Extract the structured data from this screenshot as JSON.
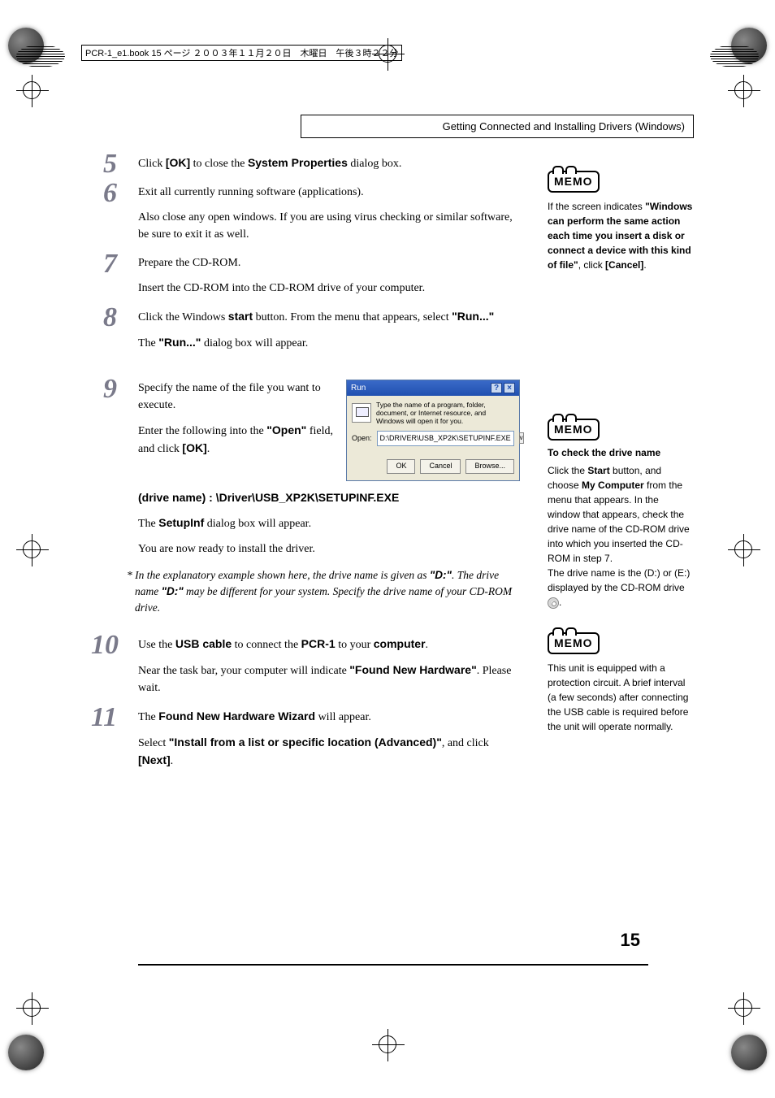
{
  "running_head": "PCR-1_e1.book 15 ページ ２００３年１１月２０日　木曜日　午後３時２２分",
  "section_title": "Getting Connected and Installing Drivers (Windows)",
  "page_number": "15",
  "steps": {
    "s5": {
      "num": "5",
      "p1_a": "Click ",
      "p1_b": "[OK]",
      "p1_c": " to close the ",
      "p1_d": "System Properties",
      "p1_e": " dialog box."
    },
    "s6": {
      "num": "6",
      "p1": "Exit all currently running software (applications).",
      "p2": "Also close any open windows. If you are using virus checking or similar software, be sure to exit it as well."
    },
    "s7": {
      "num": "7",
      "p1": "Prepare the CD-ROM.",
      "p2": "Insert the CD-ROM into the CD-ROM drive of your computer."
    },
    "s8": {
      "num": "8",
      "p1_a": "Click the Windows ",
      "p1_b": "start",
      "p1_c": " button. From the menu that appears, select ",
      "p1_d": "\"Run...\"",
      "p2_a": "The ",
      "p2_b": "\"Run...\"",
      "p2_c": " dialog box will appear."
    },
    "s9": {
      "num": "9",
      "p1": "Specify the name of the file you want to execute.",
      "p2_a": "Enter the following into the ",
      "p2_b": "\"Open\"",
      "p2_c": " field, and click ",
      "p2_d": "[OK]",
      "p2_e": ".",
      "path": "(drive name) : \\Driver\\USB_XP2K\\SETUPINF.EXE",
      "p3_a": "The ",
      "p3_b": "SetupInf",
      "p3_c": " dialog box will appear.",
      "p4": "You are now ready to install the driver.",
      "note_a": "*  In the explanatory example shown here, the drive name is given as ",
      "note_b": "\"D:\"",
      "note_c": ". The drive name ",
      "note_d": "\"D:\"",
      "note_e": " may be different for your system. Specify the drive name of your CD-ROM drive."
    },
    "s10": {
      "num": "10",
      "p1_a": "Use the ",
      "p1_b": "USB cable",
      "p1_c": " to connect the ",
      "p1_d": "PCR-1",
      "p1_e": " to your ",
      "p1_f": "computer",
      "p1_g": ".",
      "p2_a": "Near the task bar, your computer will indicate ",
      "p2_b": "\"Found New Hardware\"",
      "p2_c": ". Please wait."
    },
    "s11": {
      "num": "11",
      "p1_a": "The ",
      "p1_b": "Found New Hardware Wizard",
      "p1_c": " will appear.",
      "p2_a": "Select ",
      "p2_b": "\"Install from a list or specific location (Advanced)\"",
      "p2_c": ", and click ",
      "p2_d": "[Next]",
      "p2_e": "."
    }
  },
  "run_dialog": {
    "title": "Run",
    "help": "?",
    "close": "×",
    "desc": "Type the name of a program, folder, document, or Internet resource, and Windows will open it for you.",
    "open_label": "Open:",
    "open_value": "D:\\DRIVER\\USB_XP2K\\SETUPINF.EXE",
    "ok": "OK",
    "cancel": "Cancel",
    "browse": "Browse..."
  },
  "memos": {
    "label": "MEMO",
    "m1_a": "If the screen indicates ",
    "m1_b": "\"Windows can perform the same action each time you insert a disk or connect a device with this kind of file\"",
    "m1_c": ", click ",
    "m1_d": "[Cancel]",
    "m1_e": ".",
    "m2_title": "To check the drive name",
    "m2_a": "Click the ",
    "m2_b": "Start",
    "m2_c": " button, and choose ",
    "m2_d": "My Computer",
    "m2_e": " from the menu that appears. In the window that appears, check the drive name of the CD-ROM drive into which you inserted the CD-ROM in step 7.",
    "m2_f": "The drive name is the (D:) or (E:) displayed by the CD-ROM drive ",
    "m2_g": ".",
    "m3": "This unit is equipped with a protection circuit. A brief interval (a few seconds) after connecting the USB cable is required before the unit will operate normally."
  }
}
